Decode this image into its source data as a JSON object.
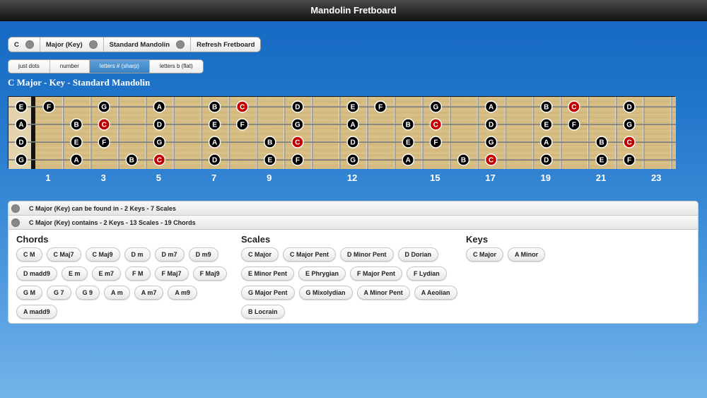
{
  "window": {
    "title": "Mandolin Fretboard"
  },
  "selectors": [
    {
      "label": "C"
    },
    {
      "label": "Major (Key)"
    },
    {
      "label": "Standard Mandolin"
    },
    {
      "label": "Refresh Fretboard"
    }
  ],
  "display_modes": [
    {
      "label": "just dots",
      "active": false
    },
    {
      "label": "number",
      "active": false
    },
    {
      "label": "letters # (sharp)",
      "active": true
    },
    {
      "label": "letters b (flat)",
      "active": false
    }
  ],
  "heading": "C Major - Key - Standard Mandolin",
  "colors": {
    "root": "#c00000",
    "note": "#000000",
    "note_text": "#ffffff"
  },
  "fretboard": {
    "frets": 24,
    "strings": [
      {
        "open": "E",
        "notes": [
          {
            "fret": 1,
            "n": "F"
          },
          {
            "fret": 3,
            "n": "G"
          },
          {
            "fret": 5,
            "n": "A"
          },
          {
            "fret": 7,
            "n": "B"
          },
          {
            "fret": 8,
            "n": "C",
            "root": true
          },
          {
            "fret": 10,
            "n": "D"
          },
          {
            "fret": 12,
            "n": "E"
          },
          {
            "fret": 13,
            "n": "F"
          },
          {
            "fret": 15,
            "n": "G"
          },
          {
            "fret": 17,
            "n": "A"
          },
          {
            "fret": 19,
            "n": "B"
          },
          {
            "fret": 20,
            "n": "C",
            "root": true
          },
          {
            "fret": 22,
            "n": "D"
          }
        ]
      },
      {
        "open": "A",
        "notes": [
          {
            "fret": 2,
            "n": "B"
          },
          {
            "fret": 3,
            "n": "C",
            "root": true
          },
          {
            "fret": 5,
            "n": "D"
          },
          {
            "fret": 7,
            "n": "E"
          },
          {
            "fret": 8,
            "n": "F"
          },
          {
            "fret": 10,
            "n": "G"
          },
          {
            "fret": 12,
            "n": "A"
          },
          {
            "fret": 14,
            "n": "B"
          },
          {
            "fret": 15,
            "n": "C",
            "root": true
          },
          {
            "fret": 17,
            "n": "D"
          },
          {
            "fret": 19,
            "n": "E"
          },
          {
            "fret": 20,
            "n": "F"
          },
          {
            "fret": 22,
            "n": "G"
          }
        ]
      },
      {
        "open": "D",
        "notes": [
          {
            "fret": 2,
            "n": "E"
          },
          {
            "fret": 3,
            "n": "F"
          },
          {
            "fret": 5,
            "n": "G"
          },
          {
            "fret": 7,
            "n": "A"
          },
          {
            "fret": 9,
            "n": "B"
          },
          {
            "fret": 10,
            "n": "C",
            "root": true
          },
          {
            "fret": 12,
            "n": "D"
          },
          {
            "fret": 14,
            "n": "E"
          },
          {
            "fret": 15,
            "n": "F"
          },
          {
            "fret": 17,
            "n": "G"
          },
          {
            "fret": 19,
            "n": "A"
          },
          {
            "fret": 21,
            "n": "B"
          },
          {
            "fret": 22,
            "n": "C",
            "root": true
          }
        ]
      },
      {
        "open": "G",
        "notes": [
          {
            "fret": 2,
            "n": "A"
          },
          {
            "fret": 4,
            "n": "B"
          },
          {
            "fret": 5,
            "n": "C",
            "root": true
          },
          {
            "fret": 7,
            "n": "D"
          },
          {
            "fret": 9,
            "n": "E"
          },
          {
            "fret": 10,
            "n": "F"
          },
          {
            "fret": 12,
            "n": "G"
          },
          {
            "fret": 14,
            "n": "A"
          },
          {
            "fret": 16,
            "n": "B"
          },
          {
            "fret": 17,
            "n": "C",
            "root": true
          },
          {
            "fret": 19,
            "n": "D"
          },
          {
            "fret": 21,
            "n": "E"
          },
          {
            "fret": 22,
            "n": "F"
          }
        ]
      }
    ],
    "fret_numbers": [
      1,
      3,
      5,
      7,
      9,
      12,
      15,
      17,
      19,
      21,
      23
    ]
  },
  "info": {
    "found_in": "C Major (Key) can be found in - 2 Keys - 7 Scales",
    "contains": "C Major (Key) contains - 2 Keys - 13 Scales - 19 Chords"
  },
  "chords": {
    "title": "Chords",
    "items": [
      "C M",
      "C Maj7",
      "C Maj9",
      "D m",
      "D m7",
      "D m9",
      "D madd9",
      "E m",
      "E m7",
      "F M",
      "F Maj7",
      "F Maj9",
      "G M",
      "G 7",
      "G 9",
      "A m",
      "A m7",
      "A m9",
      "A madd9"
    ]
  },
  "scales": {
    "title": "Scales",
    "items": [
      "C Major",
      "C Major Pent",
      "D Minor Pent",
      "D Dorian",
      "E Minor Pent",
      "E Phrygian",
      "F Major Pent",
      "F Lydian",
      "G Major Pent",
      "G Mixolydian",
      "A Minor Pent",
      "A Aeolian",
      "B Locrain"
    ]
  },
  "keys": {
    "title": "Keys",
    "items": [
      "C Major",
      "A Minor"
    ]
  }
}
